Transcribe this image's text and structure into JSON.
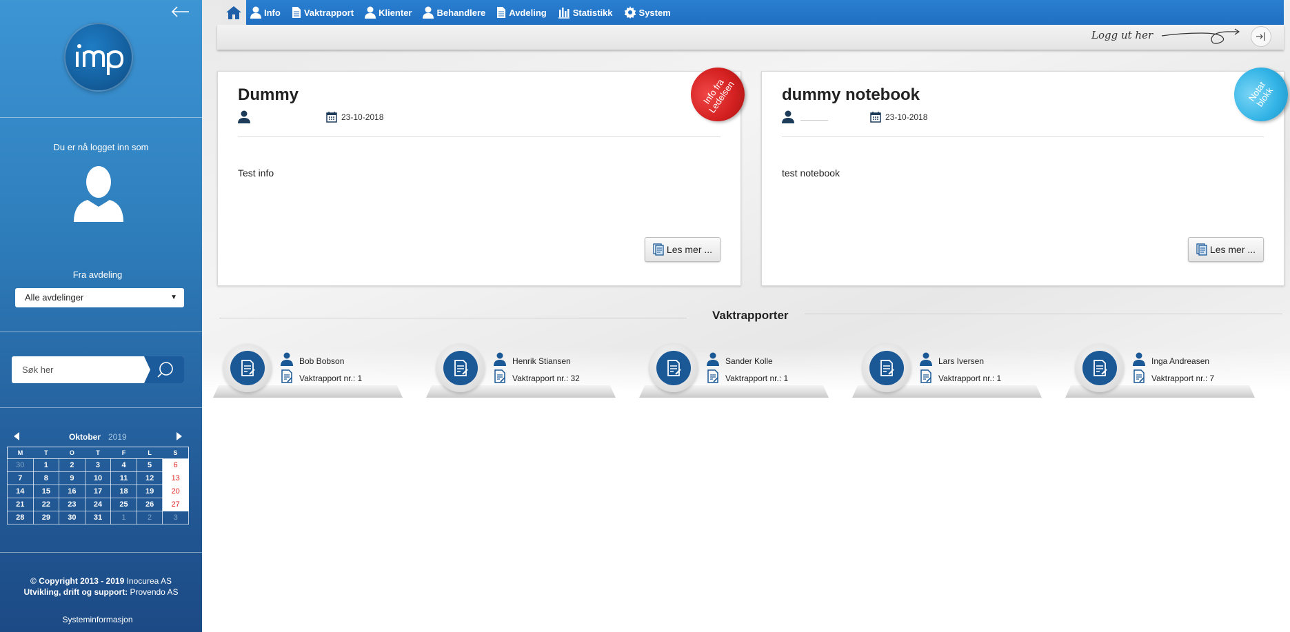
{
  "sidebar": {
    "logged_in_label": "Du er nå logget inn som",
    "department_label": "Fra avdeling",
    "department_selected": "Alle avdelinger",
    "search_placeholder": "Søk her",
    "calendar": {
      "month": "Oktober",
      "year": "2019",
      "weekdays": [
        "M",
        "T",
        "O",
        "T",
        "F",
        "L",
        "S"
      ],
      "weeks": [
        [
          "30",
          "1",
          "2",
          "3",
          "4",
          "5",
          "6"
        ],
        [
          "7",
          "8",
          "9",
          "10",
          "11",
          "12",
          "13"
        ],
        [
          "14",
          "15",
          "16",
          "17",
          "18",
          "19",
          "20"
        ],
        [
          "21",
          "22",
          "23",
          "24",
          "25",
          "26",
          "27"
        ],
        [
          "28",
          "29",
          "30",
          "31",
          "1",
          "2",
          "3"
        ]
      ]
    },
    "footer": {
      "copyright": "© Copyright 2013 - 2019",
      "company": "Inocurea AS",
      "dev_label": "Utvikling, drift og support:",
      "dev_company": "Provendo AS",
      "sysinfo": "Systeminformasjon"
    }
  },
  "nav": {
    "items": [
      {
        "label": "Info",
        "icon": "user-icon"
      },
      {
        "label": "Vaktrapport",
        "icon": "document-icon"
      },
      {
        "label": "Klienter",
        "icon": "user-icon"
      },
      {
        "label": "Behandlere",
        "icon": "user-icon"
      },
      {
        "label": "Avdeling",
        "icon": "document-icon"
      },
      {
        "label": "Statistikk",
        "icon": "bar-chart-icon"
      },
      {
        "label": "System",
        "icon": "gear-icon"
      }
    ],
    "logout_label": "Logg ut her"
  },
  "cards": [
    {
      "title": "Dummy",
      "date": "23-10-2018",
      "text": "Test info",
      "button": "Les mer ...",
      "ribbon": "Info fra Ledelsen",
      "ribbon_color": "#d42020"
    },
    {
      "title": "dummy notebook",
      "date": "23-10-2018",
      "text": "test notebook",
      "button": "Les mer ...",
      "ribbon": "Notat blokk",
      "ribbon_color": "#33b4e6"
    }
  ],
  "section_title": "Vaktrapporter",
  "reports": [
    {
      "name": "Bob Bobson",
      "number": "Vaktrapport nr.: 1"
    },
    {
      "name": "Henrik Stiansen",
      "number": "Vaktrapport nr.: 32"
    },
    {
      "name": "Sander Kolle",
      "number": "Vaktrapport nr.: 1"
    },
    {
      "name": "Lars Iversen",
      "number": "Vaktrapport nr.: 1"
    },
    {
      "name": "Inga Andreasen",
      "number": "Vaktrapport nr.: 7"
    }
  ],
  "colors": {
    "nav_blue": "#1f6fc2",
    "sidebar_blue": "#2f7fbd",
    "report_blue": "#1a5896",
    "weekend_red": "#e02020"
  }
}
